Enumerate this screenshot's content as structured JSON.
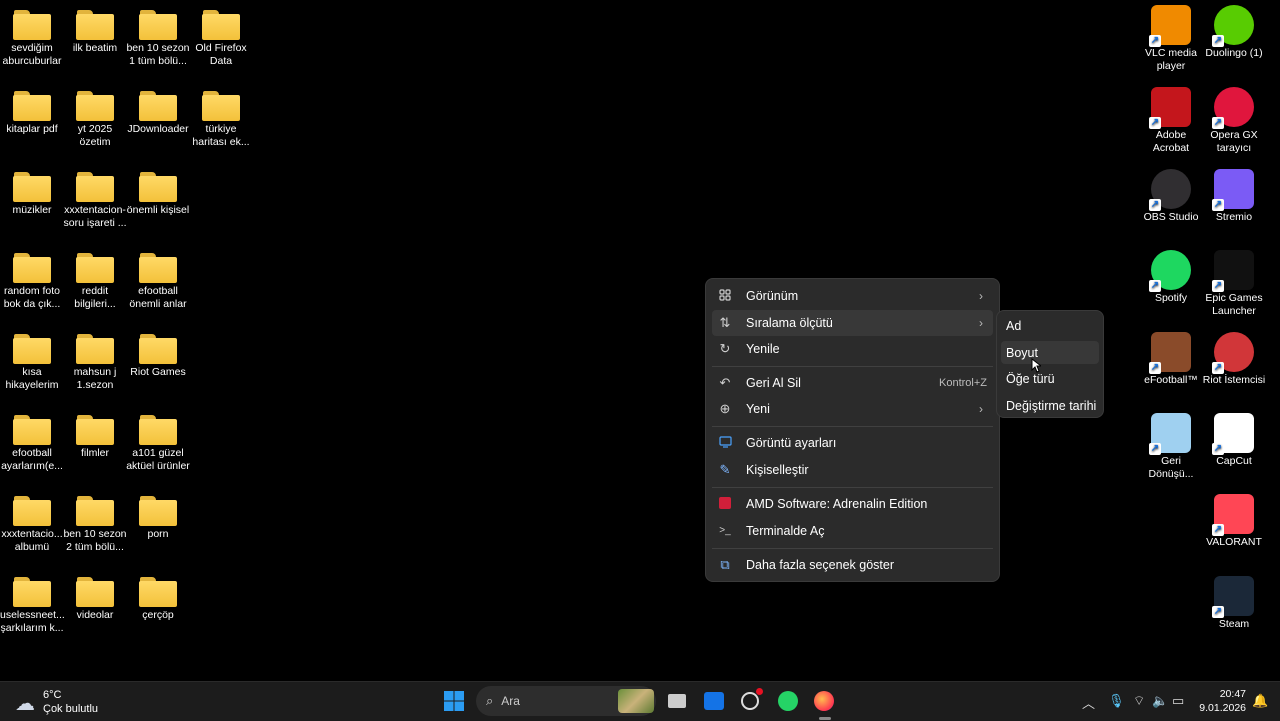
{
  "desktop": {
    "left_icons": [
      {
        "label": "sevdiğim\naburcuburlar"
      },
      {
        "label": "ilk beatim"
      },
      {
        "label": "ben 10 sezon\n1 tüm bölü..."
      },
      {
        "label": "Old Firefox\nData"
      },
      {
        "label": "kitaplar pdf"
      },
      {
        "label": "yt 2025\nözetim"
      },
      {
        "label": "JDownloader"
      },
      {
        "label": "türkiye\nharitası ek..."
      },
      {
        "label": "müzikler"
      },
      {
        "label": "xxxtentacion-\nsoru işareti ..."
      },
      {
        "label": "önemli kişisel"
      },
      {
        "label": "random foto\nbok da çık..."
      },
      {
        "label": "reddit\nbilgileri..."
      },
      {
        "label": "efootball\nönemli anlar"
      },
      {
        "label": "kısa\nhikayelerim"
      },
      {
        "label": "mahsun j\n1.sezon"
      },
      {
        "label": "Riot Games"
      },
      {
        "label": "efootball\nayarlarım(e..."
      },
      {
        "label": "filmler"
      },
      {
        "label": "a101 güzel\naktüel ürünler"
      },
      {
        "label": "xxxtentacio...\nalbumü"
      },
      {
        "label": "ben 10 sezon\n2 tüm bölü..."
      },
      {
        "label": "porn"
      },
      {
        "label": "uselessneet...\nşarkılarım k..."
      },
      {
        "label": "videolar"
      },
      {
        "label": "çerçöp"
      }
    ],
    "right_icons": [
      {
        "label": "VLC media\nplayer",
        "icon": "vlc-icon",
        "color": "#f08a00"
      },
      {
        "label": "Duolingo (1)",
        "icon": "duolingo-icon",
        "color": "#58cc02"
      },
      {
        "label": "Adobe\nAcrobat",
        "icon": "acrobat-icon",
        "color": "#c4161c"
      },
      {
        "label": "Opera GX\ntarayıcı",
        "icon": "opera-gx-icon",
        "color": "#e0163d"
      },
      {
        "label": "OBS Studio",
        "icon": "obs-icon",
        "color": "#302e31"
      },
      {
        "label": "Stremio",
        "icon": "stremio-icon",
        "color": "#7b5bf5"
      },
      {
        "label": "Spotify",
        "icon": "spotify-icon",
        "color": "#1ed760"
      },
      {
        "label": "Epic Games\nLauncher",
        "icon": "epic-games-icon",
        "color": "#111111"
      },
      {
        "label": "eFootball™",
        "icon": "efootball-icon",
        "color": "#8a4b2a"
      },
      {
        "label": "Riot İstemcisi",
        "icon": "riot-client-icon",
        "color": "#d13639"
      },
      {
        "label": "Geri\nDönüşü...",
        "icon": "recycle-bin-icon",
        "color": "#9fd0f0"
      },
      {
        "label": "CapCut",
        "icon": "capcut-icon",
        "color": "#ffffff"
      },
      {
        "label": "VALORANT",
        "icon": "valorant-icon",
        "color": "#ff4655"
      },
      {
        "label": "Steam",
        "icon": "steam-icon",
        "color": "#1b2838"
      }
    ]
  },
  "context_menu": {
    "items": [
      {
        "label": "Görünüm",
        "icon": "grid-icon",
        "arrow": "›"
      },
      {
        "label": "Sıralama ölçütü",
        "icon": "sort-icon",
        "arrow": "›"
      },
      {
        "label": "Yenile",
        "icon": "refresh-icon"
      },
      {
        "label": "Geri Al Sil",
        "icon": "undo-icon",
        "shortcut": "Kontrol+Z"
      },
      {
        "label": "Yeni",
        "icon": "plus-circle-icon",
        "arrow": "›"
      },
      {
        "label": "Görüntü ayarları",
        "icon": "display-icon"
      },
      {
        "label": "Kişiselleştir",
        "icon": "brush-icon"
      },
      {
        "label": "AMD Software: Adrenalin Edition",
        "icon": "amd-icon"
      },
      {
        "label": "Terminalde Aç",
        "icon": "terminal-icon"
      },
      {
        "label": "Daha fazla seçenek göster",
        "icon": "more-options-icon"
      }
    ],
    "submenu": [
      {
        "label": "Ad"
      },
      {
        "label": "Boyut"
      },
      {
        "label": "Öğe türü"
      },
      {
        "label": "Değiştirme tarihi"
      }
    ]
  },
  "taskbar": {
    "weather_temp": "6°C",
    "weather_desc": "Çok bulutlu",
    "search_placeholder": "Ara",
    "time": "20:47",
    "date": "9.01.2026"
  }
}
